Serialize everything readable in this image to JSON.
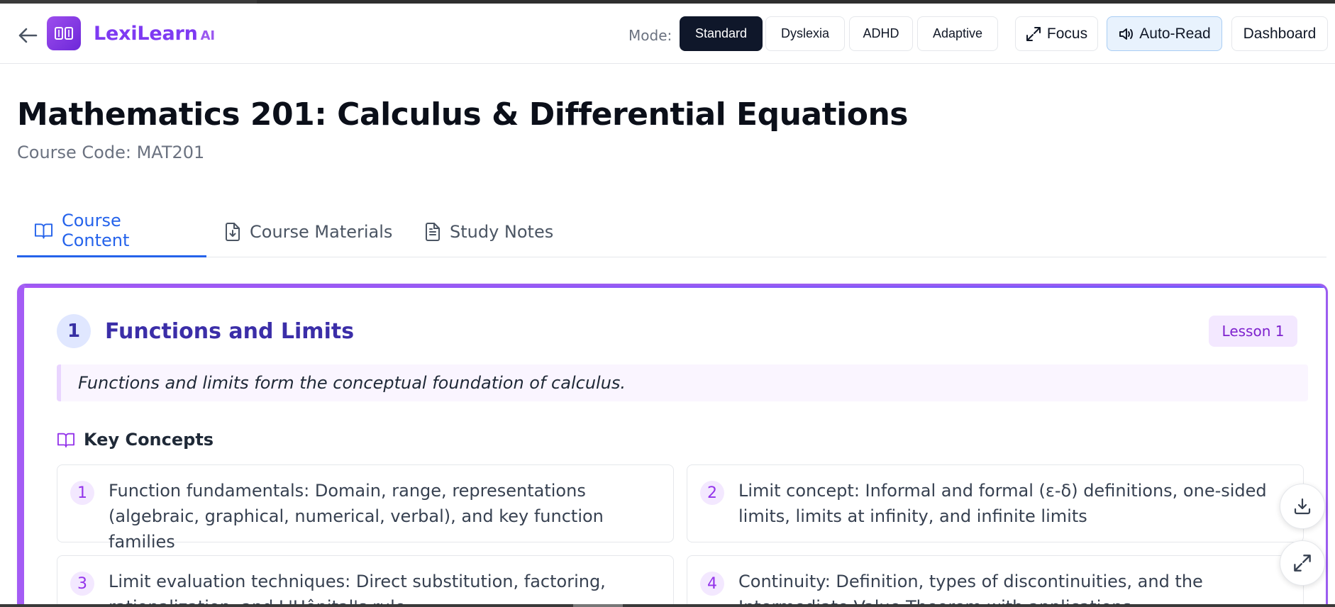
{
  "header": {
    "brand": "LexiLearn",
    "brand_suffix": "AI",
    "mode_label": "Mode:",
    "modes": [
      {
        "label": "Standard",
        "active": true
      },
      {
        "label": "Dyslexia",
        "active": false
      },
      {
        "label": "ADHD",
        "active": false
      },
      {
        "label": "Adaptive",
        "active": false
      }
    ],
    "focus_label": "Focus",
    "autoread_label": "Auto-Read",
    "dashboard_label": "Dashboard"
  },
  "course": {
    "title": "Mathematics 201: Calculus & Differential Equations",
    "code": "Course Code: MAT201"
  },
  "tabs": [
    {
      "label": "Course Content",
      "icon": "book-open-icon",
      "active": true
    },
    {
      "label": "Course Materials",
      "icon": "file-download-icon",
      "active": false
    },
    {
      "label": "Study Notes",
      "icon": "file-text-icon",
      "active": false
    }
  ],
  "lesson": {
    "number": "1",
    "title": "Functions and Limits",
    "badge": "Lesson 1",
    "summary": "Functions and limits form the conceptual foundation of calculus.",
    "key_concepts_label": "Key Concepts",
    "concepts": [
      {
        "num": "1",
        "text": "Function fundamentals: Domain, range, representations (algebraic, graphical, numerical, verbal), and key function families"
      },
      {
        "num": "2",
        "text": "Limit concept: Informal and formal (ε-δ) definitions, one-sided limits, limits at infinity, and infinite limits"
      },
      {
        "num": "3",
        "text": "Limit evaluation techniques: Direct substitution, factoring, rationalization, and L'Hôpital's rule"
      },
      {
        "num": "4",
        "text": "Continuity: Definition, types of discontinuities, and the Intermediate Value Theorem with applications"
      }
    ]
  },
  "colors": {
    "accent": "#7e3af2",
    "active_tab": "#2563eb",
    "lesson_title": "#3b2ea8"
  }
}
